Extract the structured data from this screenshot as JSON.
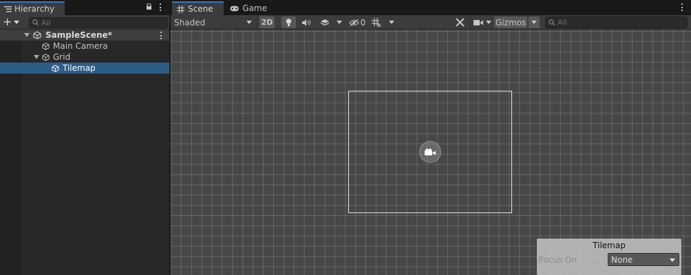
{
  "hierarchy": {
    "tab_label": "Hierarchy",
    "add_label": "+",
    "search_placeholder": "All",
    "items": [
      {
        "label": "SampleScene*",
        "type": "scene"
      },
      {
        "label": "Main Camera",
        "type": "gameobject"
      },
      {
        "label": "Grid",
        "type": "gameobject"
      },
      {
        "label": "Tilemap",
        "type": "gameobject",
        "selected": true
      }
    ]
  },
  "scene_view": {
    "tabs": [
      {
        "label": "Scene",
        "icon": "grid-icon",
        "active": true
      },
      {
        "label": "Game",
        "icon": "gamepad-icon",
        "active": false
      }
    ],
    "toolbar": {
      "shading_mode": "Shaded",
      "mode_2d_label": "2D",
      "hidden_count": "0",
      "gizmos_label": "Gizmos",
      "search_placeholder": "All"
    },
    "overlay": {
      "title": "Tilemap",
      "focus_label": "Focus On",
      "focus_value": "None"
    }
  },
  "colors": {
    "accent": "#3a79bb",
    "selection": "#2c5d87",
    "panel": "#282828",
    "viewport": "#474747"
  }
}
